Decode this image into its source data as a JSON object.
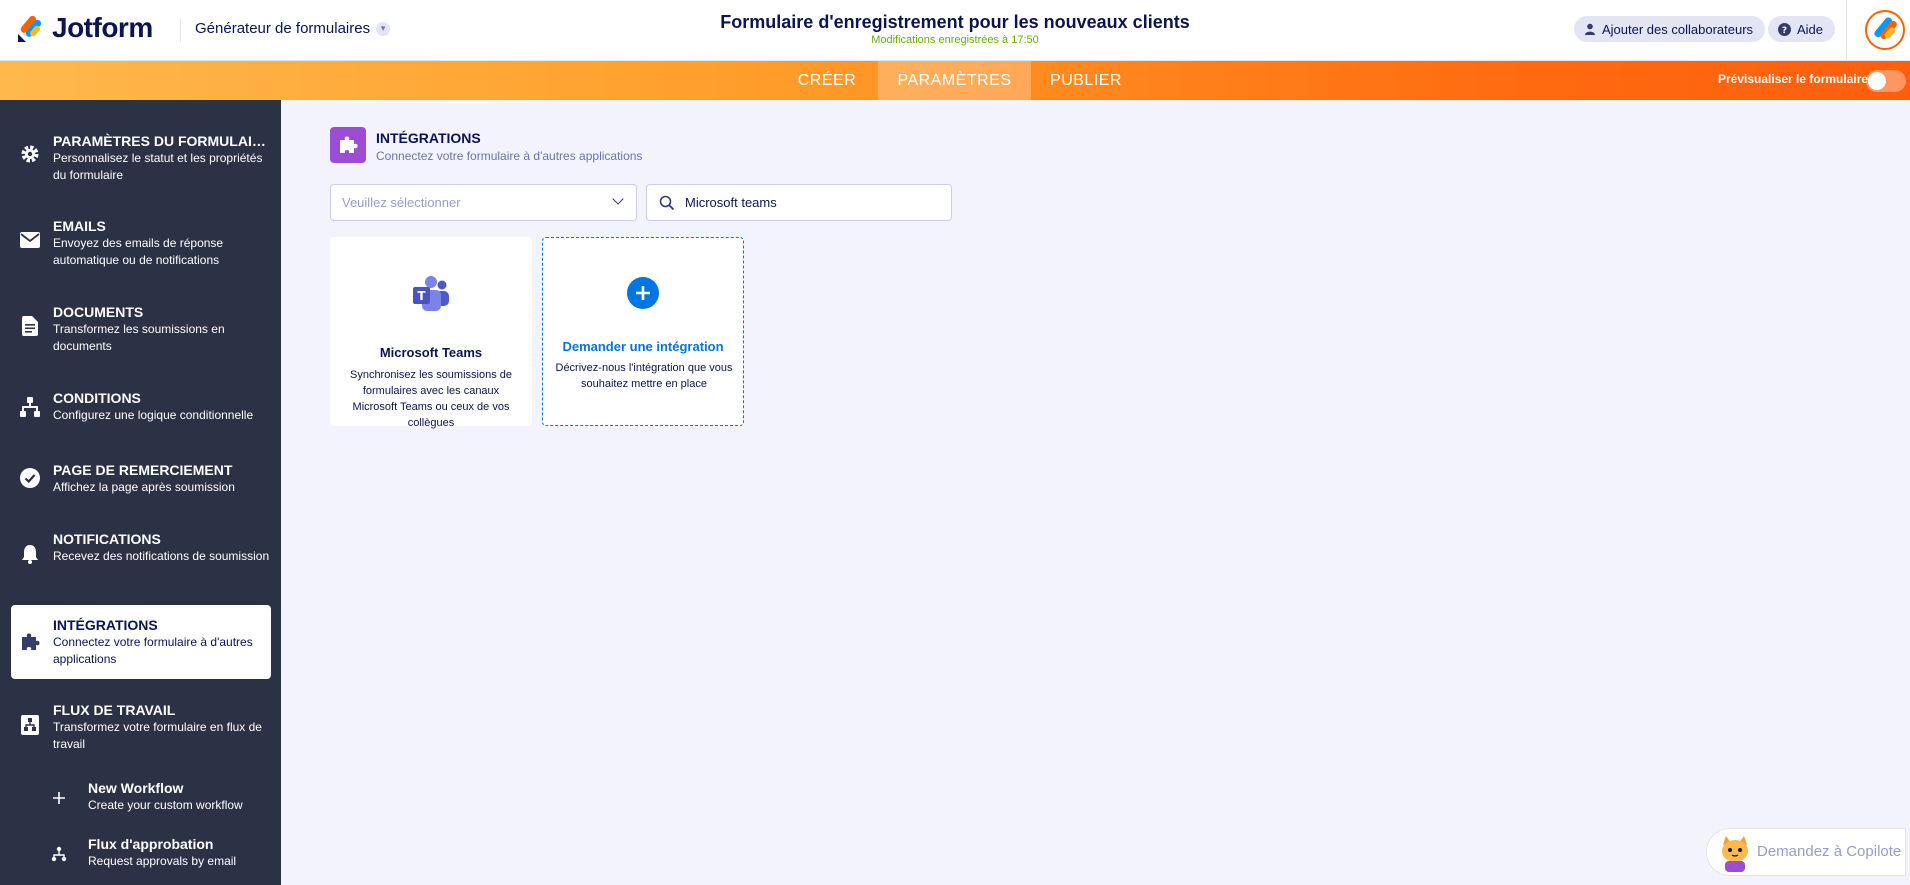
{
  "header": {
    "logo_text": "Jotform",
    "builder_label": "Générateur de formulaires",
    "form_title": "Formulaire d'enregistrement pour les nouveaux clients",
    "saved_status": "Modifications enregistrées à 17:50",
    "collaborators_label": "Ajouter des collaborateurs",
    "help_label": "Aide"
  },
  "nav": {
    "tabs": [
      {
        "label": "CRÉER"
      },
      {
        "label": "PARAMÈTRES"
      },
      {
        "label": "PUBLIER"
      }
    ],
    "active_tab": "PARAMÈTRES",
    "preview_label": "Prévisualiser le formulaire",
    "preview_enabled": false
  },
  "sidebar": {
    "items": [
      {
        "title": "PARAMÈTRES DU FORMULAIRE",
        "desc": "Personnalisez le statut et les propriétés du formulaire",
        "icon": "gear-icon"
      },
      {
        "title": "EMAILS",
        "desc": "Envoyez des emails de réponse automatique ou de notifications",
        "icon": "envelope-icon"
      },
      {
        "title": "DOCUMENTS",
        "desc": "Transformez les soumissions en documents",
        "icon": "document-icon"
      },
      {
        "title": "CONDITIONS",
        "desc": "Configurez une logique conditionnelle",
        "icon": "hierarchy-icon"
      },
      {
        "title": "PAGE DE REMERCIEMENT",
        "desc": "Affichez la page après soumission",
        "icon": "check-circle-icon"
      },
      {
        "title": "NOTIFICATIONS",
        "desc": "Recevez des notifications de soumission",
        "icon": "bell-icon"
      },
      {
        "title": "INTÉGRATIONS",
        "desc": "Connectez votre formulaire à d'autres applications",
        "icon": "puzzle-icon"
      },
      {
        "title": "FLUX DE TRAVAIL",
        "desc": "Transformez votre formulaire en flux de travail",
        "icon": "workflow-icon"
      }
    ],
    "active_item": "INTÉGRATIONS",
    "sub_items": [
      {
        "title": "New Workflow",
        "desc": "Create your custom workflow",
        "icon": "plus-icon"
      },
      {
        "title": "Flux d'approbation",
        "desc": "Request approvals by email",
        "icon": "approval-flow-icon"
      }
    ]
  },
  "main": {
    "section_title": "INTÉGRATIONS",
    "section_desc": "Connectez votre formulaire à d'autres applications",
    "select_placeholder": "Veuillez sélectionner",
    "search_value": "Microsoft teams",
    "cards": [
      {
        "title": "Microsoft Teams",
        "desc": "Synchronisez les soumissions de formulaires avec les canaux Microsoft Teams ou ceux de vos collègues",
        "icon": "microsoft-teams-icon"
      },
      {
        "title": "Demander une intégration",
        "desc": "Décrivez-nous l'intégration que vous souhaitez mettre en place",
        "icon": "plus-circle-icon"
      }
    ]
  },
  "copilot": {
    "label": "Demandez à Copilote"
  },
  "colors": {
    "brand_navy": "#0a1551",
    "accent_orange": "#ff6100",
    "sidebar_bg": "#2b3245",
    "link_blue": "#0075e3",
    "integrations_purple": "#9c4dd3",
    "saved_green": "#64b200"
  }
}
